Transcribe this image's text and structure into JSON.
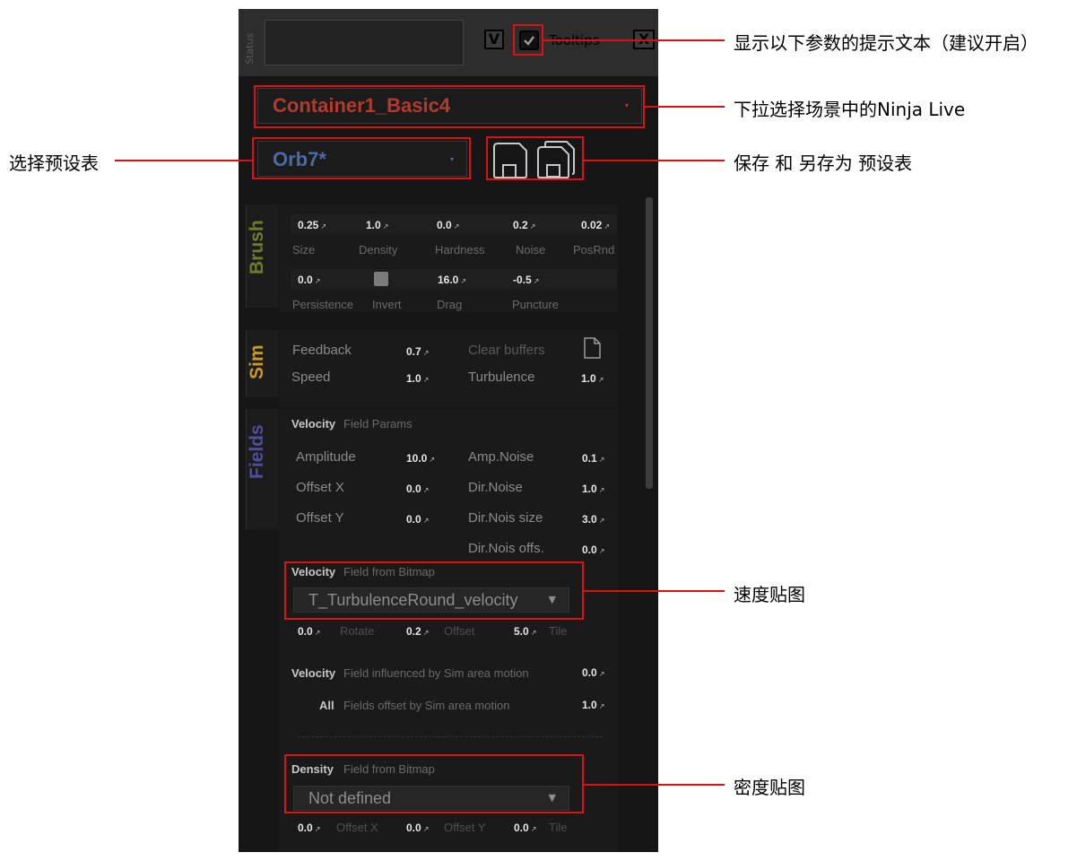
{
  "toolbar": {
    "status_label": "Status",
    "v_button": "V",
    "tooltips_label": "Tooltips",
    "close_button": "X"
  },
  "container_dropdown": {
    "value": "Container1_Basic4",
    "arrow": "▾"
  },
  "preset_dropdown": {
    "value": "Orb7*",
    "arrow": "▾"
  },
  "tabs": {
    "brush": "Brush",
    "sim": "Sim",
    "fields": "Fields"
  },
  "brush": {
    "row1": [
      {
        "value": "0.25",
        "label": "Size"
      },
      {
        "value": "1.0",
        "label": "Density"
      },
      {
        "value": "0.0",
        "label": "Hardness"
      },
      {
        "value": "0.2",
        "label": "Noise"
      },
      {
        "value": "0.02",
        "label": "PosRnd"
      }
    ],
    "row2": [
      {
        "value": "0.0",
        "label": "Persistence"
      },
      {
        "value": "",
        "label": "Invert"
      },
      {
        "value": "16.0",
        "label": "Drag"
      },
      {
        "value": "-0.5",
        "label": "Puncture"
      }
    ]
  },
  "sim": {
    "feedback_label": "Feedback",
    "feedback_value": "0.7",
    "speed_label": "Speed",
    "speed_value": "1.0",
    "clear_buffers_label": "Clear buffers",
    "turbulence_label": "Turbulence",
    "turbulence_value": "1.0"
  },
  "fields": {
    "params_title": "Velocity",
    "params_sub": "Field Params",
    "amplitude_label": "Amplitude",
    "amplitude_value": "10.0",
    "offset_x_label": "Offset X",
    "offset_x_value": "0.0",
    "offset_y_label": "Offset Y",
    "offset_y_value": "0.0",
    "amp_noise_label": "Amp.Noise",
    "amp_noise_value": "0.1",
    "dir_noise_label": "Dir.Noise",
    "dir_noise_value": "1.0",
    "dir_nois_size_label": "Dir.Nois size",
    "dir_nois_size_value": "3.0",
    "dir_nois_offs_label": "Dir.Nois offs.",
    "dir_nois_offs_value": "0.0",
    "vel_bitmap_title": "Velocity",
    "vel_bitmap_sub": "Field from Bitmap",
    "vel_bitmap_value": "T_TurbulenceRound_velocity",
    "vel_rotate_value": "0.0",
    "vel_rotate_label": "Rotate",
    "vel_offset_value": "0.2",
    "vel_offset_label": "Offset",
    "vel_tile_value": "5.0",
    "vel_tile_label": "Tile",
    "vel_motion_title": "Velocity",
    "vel_motion_sub": "Field influenced by Sim area motion",
    "vel_motion_value": "0.0",
    "all_title": "All",
    "all_sub": "Fields offset by Sim area motion",
    "all_value": "1.0",
    "den_bitmap_title": "Density",
    "den_bitmap_sub": "Field from Bitmap",
    "den_bitmap_value": "Not defined",
    "den_offx_value": "0.0",
    "den_offx_label": "Offset X",
    "den_offy_value": "0.0",
    "den_offy_label": "Offset Y",
    "den_tile_value": "0.0",
    "den_tile_label": "Tile",
    "dd_arrow": "▼"
  },
  "annotations": {
    "tooltips_note": "显示以下参数的提示文本（建议开启）",
    "container_note": "下拉选择场景中的Ninja Live",
    "preset_select_note": "选择预设表",
    "save_note": "保存 和 另存为 预设表",
    "velocity_map_note": "速度贴图",
    "density_map_note": "密度贴图"
  },
  "colors": {
    "annotation_red": "#dd1111",
    "container_text": "#b53a2c",
    "preset_text": "#4b69a8",
    "brush_tab": "#6e7b2c",
    "sim_tab": "#c79a26",
    "fields_tab": "#514c9b"
  }
}
